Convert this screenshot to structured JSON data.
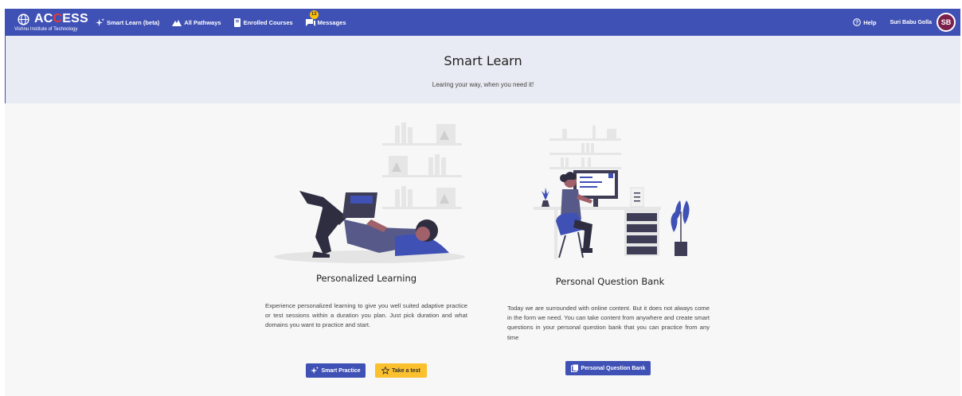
{
  "brand": {
    "name_prefix": "AC",
    "name_highlight": "C",
    "name_suffix": "ESS",
    "subtitle": "Vishnu Institute of Technology"
  },
  "nav": {
    "items": [
      {
        "label": "Smart Learn (beta)",
        "icon": "sparkle-icon"
      },
      {
        "label": "All Pathways",
        "icon": "mountain-icon"
      },
      {
        "label": "Enrolled Courses",
        "icon": "book-icon"
      },
      {
        "label": "Messages",
        "icon": "chat-icon",
        "badge": "13"
      }
    ],
    "help_label": "Help",
    "user_name": "Suri Babu Golla",
    "user_initials": "SB"
  },
  "hero": {
    "title": "Smart Learn",
    "subtitle": "Learing your way, when you need it!"
  },
  "cards": [
    {
      "title": "Personalized Learning",
      "text": "Experience personalized learning to give you well suited adaptive practice or test sessions within a duration you plan. Just pick duration and what domains you want to practice and start.",
      "buttons": [
        {
          "label": "Smart Practice"
        },
        {
          "label": "Take a test"
        }
      ]
    },
    {
      "title": "Personal Question Bank",
      "text": "Today we are surrounded with online content. But it does not always come in the form we need. You can take content from anywhere and create smart questions in your personal question bank that you can practice from any time",
      "buttons": [
        {
          "label": "Personal Question Bank"
        }
      ]
    }
  ],
  "colors": {
    "primary": "#3f51b5",
    "accent_yellow": "#fbc02d",
    "avatar_bg": "#7b1f4b",
    "hero_bg": "#e8ebf3"
  }
}
